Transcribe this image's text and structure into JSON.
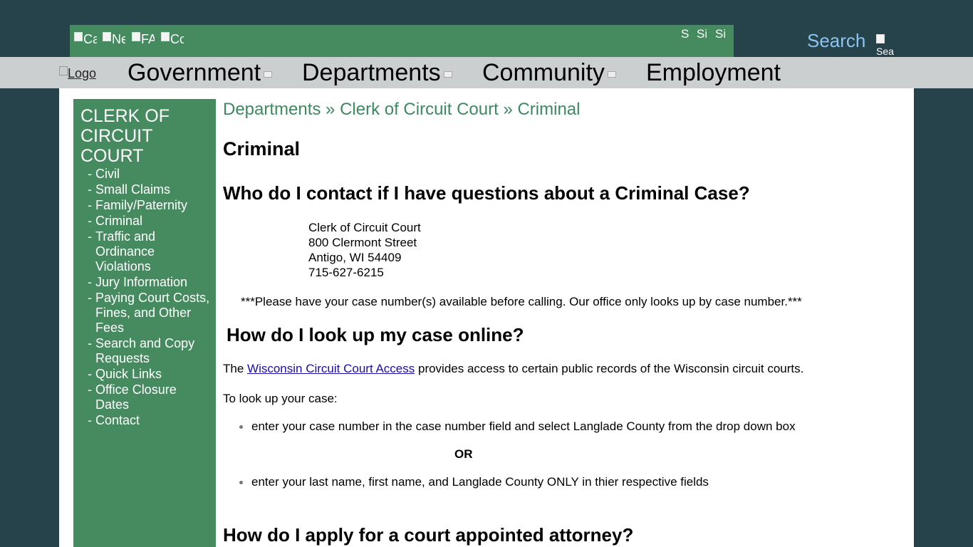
{
  "topbar": {
    "quick_links": [
      "Calendar",
      "News",
      "FAQ",
      "Contact"
    ],
    "social_icons": [
      "S",
      "Si",
      "Si"
    ],
    "search_label": "Search",
    "search_image_alt": "Sea"
  },
  "nav": {
    "logo_alt": "Logo",
    "items": [
      "Government",
      "Departments",
      "Community",
      "Employment"
    ]
  },
  "sidebar": {
    "title": "CLERK OF CIRCUIT COURT",
    "items": [
      "Civil",
      "Small Claims",
      "Family/Paternity",
      "Criminal",
      "Traffic and Ordinance Violations",
      "Jury Information",
      "Paying Court Costs, Fines, and Other Fees",
      "Search and Copy Requests",
      "Quick Links",
      "Office Closure Dates",
      "Contact"
    ]
  },
  "main": {
    "breadcrumb": "Departments » Clerk of Circuit Court » Criminal",
    "title": "Criminal",
    "q1": "Who do I contact if I have questions about a Criminal Case?",
    "address": {
      "line1": "Clerk of Circuit Court",
      "line2": "800 Clermont Street",
      "line3": "Antigo, WI 54409",
      "phone": "715-627-6215"
    },
    "note": "***Please have your case number(s) available before calling.  Our office only looks up by case number.***",
    "q2": "How do I look up my case online?",
    "p1_before": "The ",
    "p1_link": "Wisconsin Circuit Court Access",
    "p1_after": " provides access to certain public records of the Wisconsin circuit courts.",
    "p2": "To look up your case:",
    "bullet1": "enter your case number in the case number field and select Langlade County from the drop down box",
    "or": "OR",
    "bullet2": "enter your last name, first name, and Langlade County ONLY in thier respective fields",
    "q3": "How do I apply for a court appointed attorney?"
  },
  "colors": {
    "background": "#26424a",
    "green": "#468a60",
    "nav_gray": "#cbcfd0",
    "breadcrumb_green": "#3d8a5f",
    "search_blue": "#8bc4ee"
  }
}
